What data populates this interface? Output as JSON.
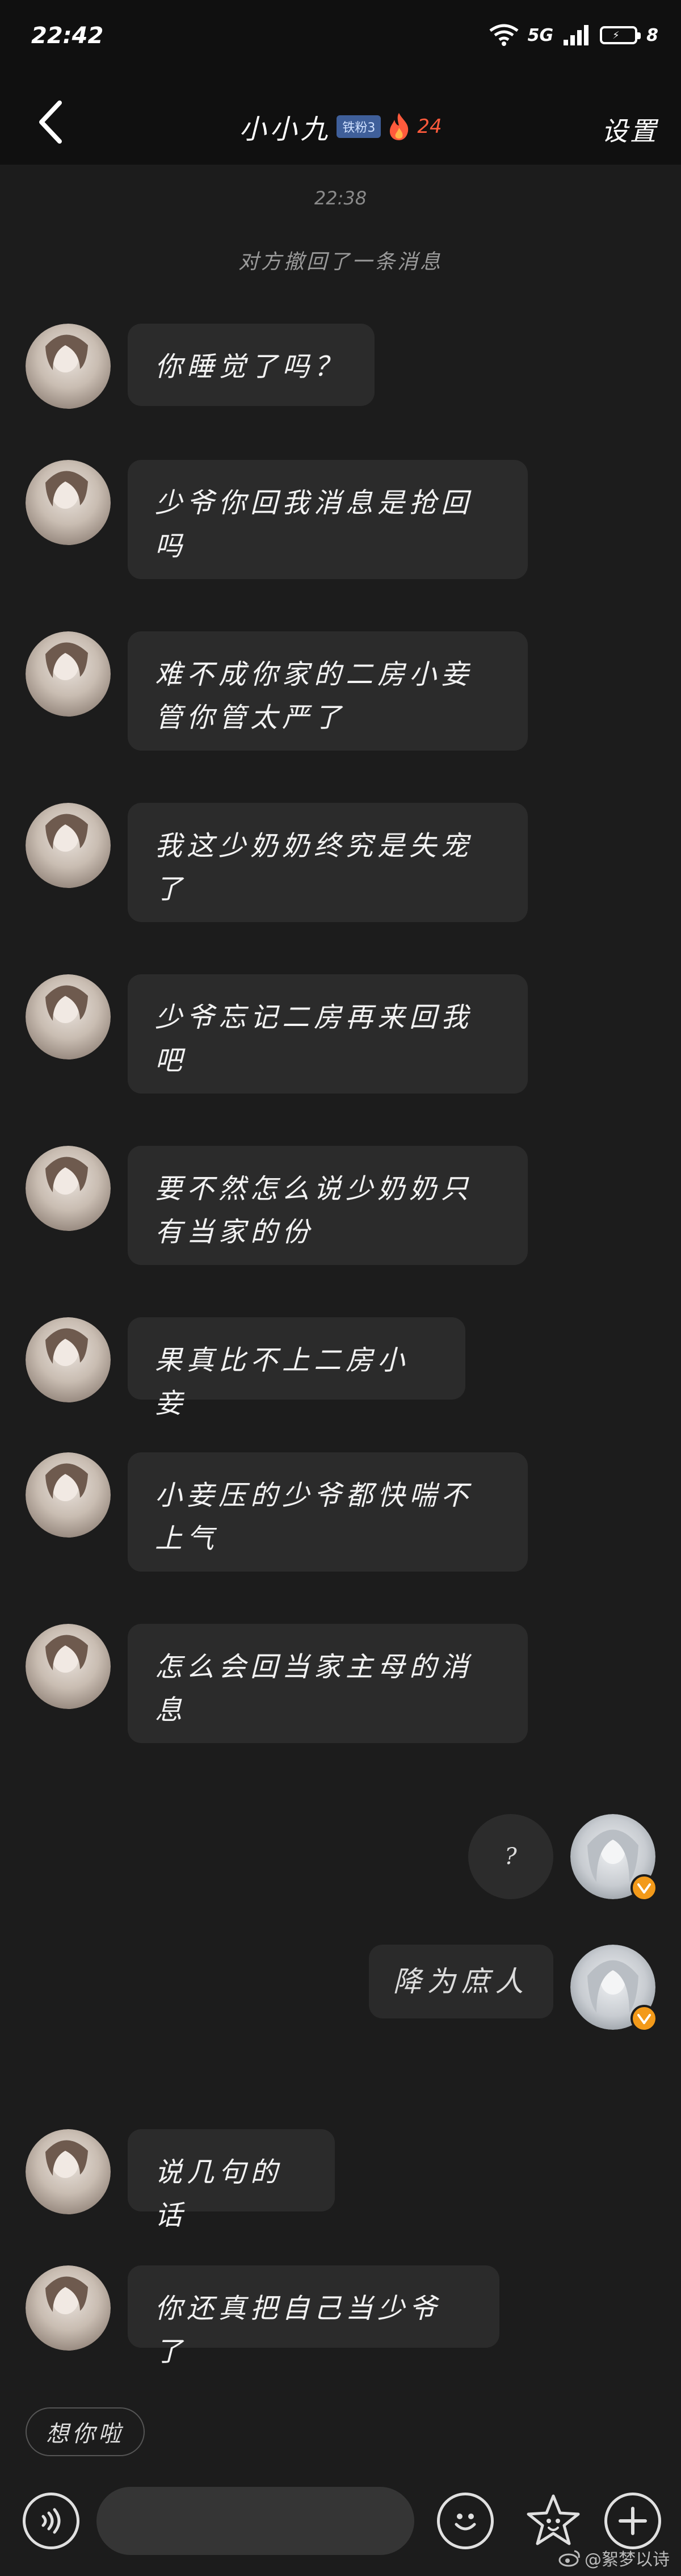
{
  "status_bar": {
    "time": "22:42",
    "network": "5G",
    "battery": "8"
  },
  "header": {
    "back_label": "返回",
    "title": "小小九",
    "level_badge": "铁粉3",
    "streak": "24",
    "settings_label": "设置"
  },
  "chat": {
    "timestamp": "22:38",
    "recall_notice": "对方撤回了一条消息",
    "messages": [
      {
        "side": "left",
        "text": "你睡觉了吗？"
      },
      {
        "side": "left",
        "text": "少爷你回我消息是抢回吗"
      },
      {
        "side": "left",
        "text": "难不成你家的二房小妾管你管太严了"
      },
      {
        "side": "left",
        "text": "我这少奶奶终究是失宠了"
      },
      {
        "side": "left",
        "text": "少爷忘记二房再来回我吧"
      },
      {
        "side": "left",
        "text": "要不然怎么说少奶奶只有当家的份"
      },
      {
        "side": "left",
        "text": "果真比不上二房小妾"
      },
      {
        "side": "left",
        "text": "小妾压的少爷都快喘不上气"
      },
      {
        "side": "left",
        "text": "怎么会回当家主母的消息"
      },
      {
        "side": "right",
        "text": "?"
      },
      {
        "side": "right",
        "text": "降为庶人"
      },
      {
        "side": "left",
        "text": "说几句的话"
      },
      {
        "side": "left",
        "text": "你还真把自己当少爷了"
      }
    ]
  },
  "quick_reply": {
    "label": "想你啦"
  },
  "input": {
    "placeholder": ""
  },
  "watermark": {
    "text": "@絮梦以诗"
  },
  "colors": {
    "background": "#1c1c1c",
    "bubble": "#2b2b2b",
    "badge": "#3f5f9a",
    "streak": "#ff5a3c",
    "verified": "#f39a1a"
  }
}
